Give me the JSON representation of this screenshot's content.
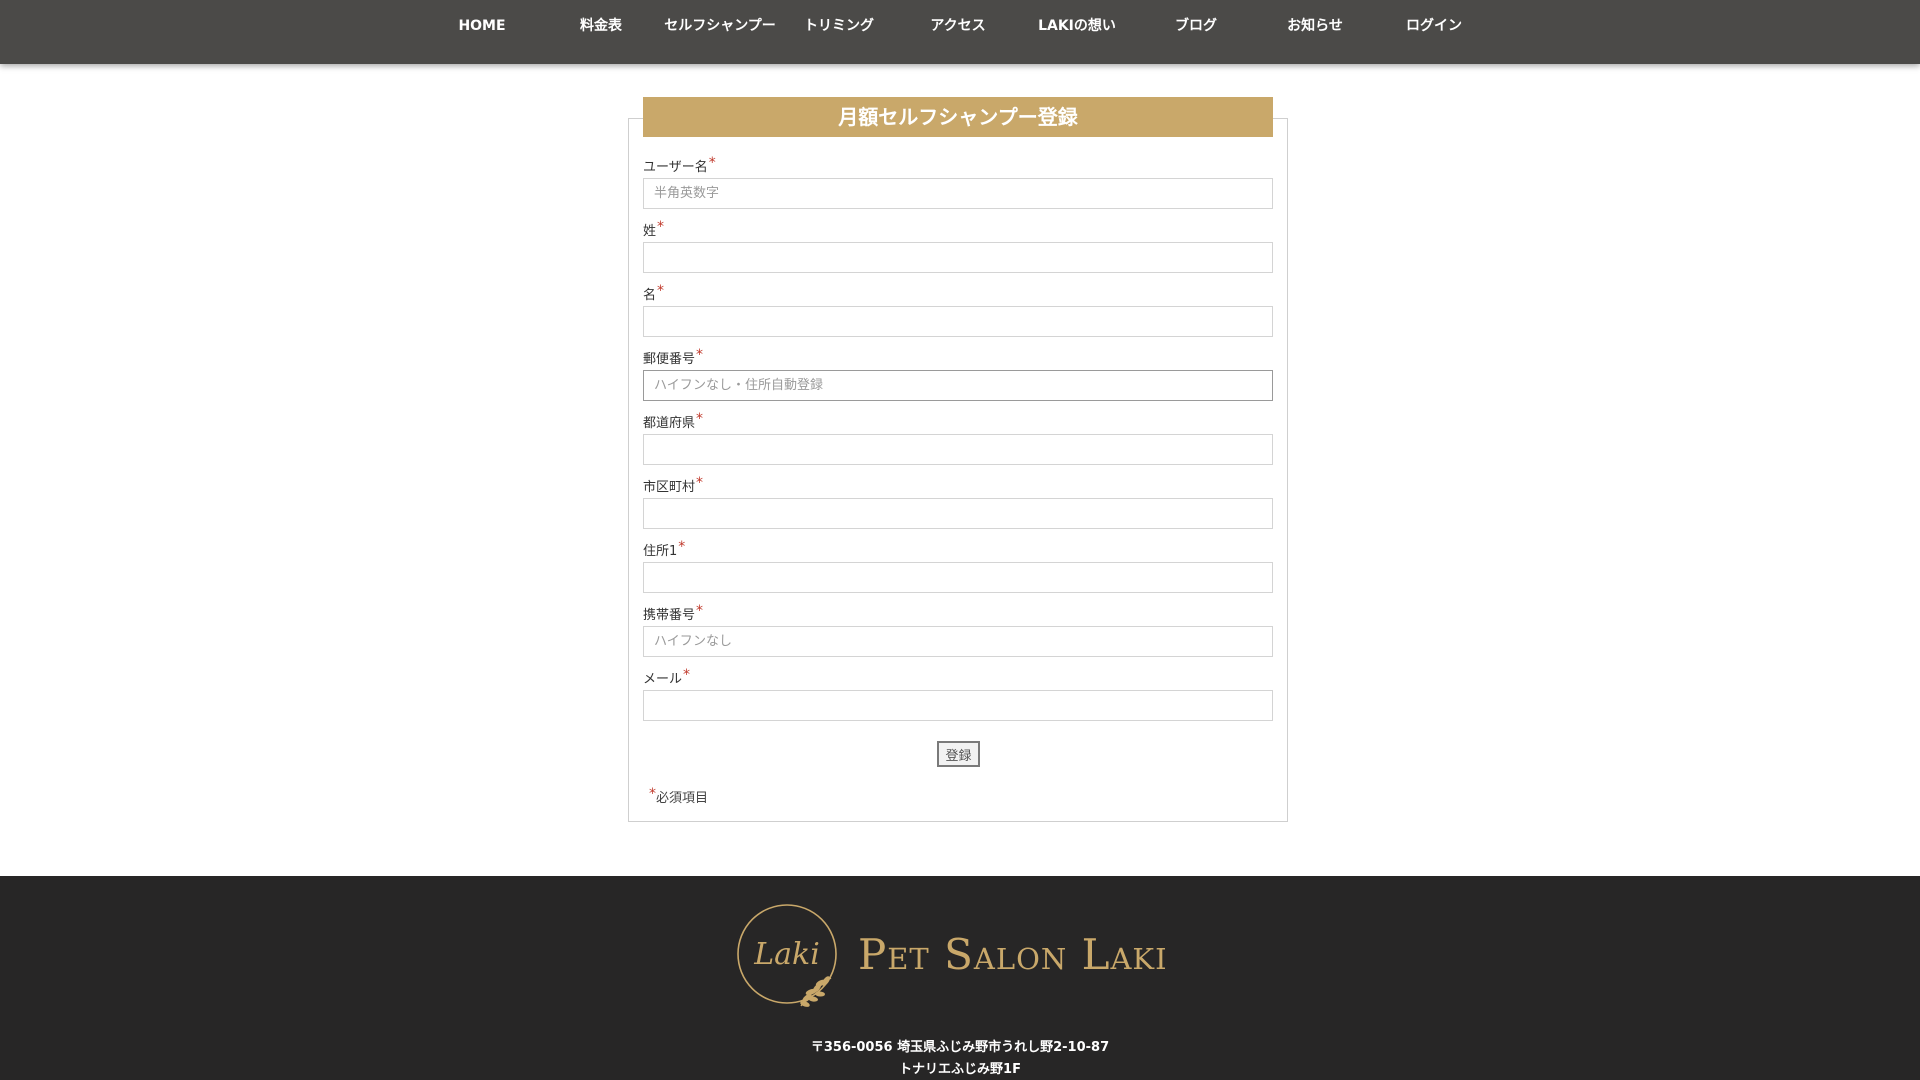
{
  "nav": {
    "items": [
      {
        "label": "HOME"
      },
      {
        "label": "料金表"
      },
      {
        "label": "セルフシャンプー"
      },
      {
        "label": "トリミング"
      },
      {
        "label": "アクセス"
      },
      {
        "label": "LAKIの想い"
      },
      {
        "label": "ブログ"
      },
      {
        "label": "お知らせ"
      },
      {
        "label": "ログイン"
      }
    ]
  },
  "form": {
    "title": "月額セルフシャンプー登録",
    "required_mark": "*",
    "fields": [
      {
        "label": "ユーザー名",
        "placeholder": "半角英数字",
        "value": ""
      },
      {
        "label": "姓",
        "placeholder": "",
        "value": ""
      },
      {
        "label": "名",
        "placeholder": "",
        "value": ""
      },
      {
        "label": "郵便番号",
        "placeholder": "ハイフンなし・住所自動登録",
        "value": ""
      },
      {
        "label": "都道府県",
        "placeholder": "",
        "value": ""
      },
      {
        "label": "市区町村",
        "placeholder": "",
        "value": ""
      },
      {
        "label": "住所1",
        "placeholder": "",
        "value": ""
      },
      {
        "label": "携帯番号",
        "placeholder": "ハイフンなし",
        "value": ""
      },
      {
        "label": "メール",
        "placeholder": "",
        "value": ""
      }
    ],
    "submit_label": "登録",
    "required_note": "必須項目"
  },
  "footer": {
    "logo_mark_text": "Laki",
    "logo_text": "Pet Salon Laki",
    "address_line1": "〒356-0056 埼玉県ふじみ野市うれし野2-10-87",
    "address_line2": "トナリエふじみ野1F"
  },
  "colors": {
    "nav_bg": "#4b4a48",
    "accent_gold": "#c9a86a",
    "footer_bg": "#272626",
    "required_red": "#c0392b"
  }
}
